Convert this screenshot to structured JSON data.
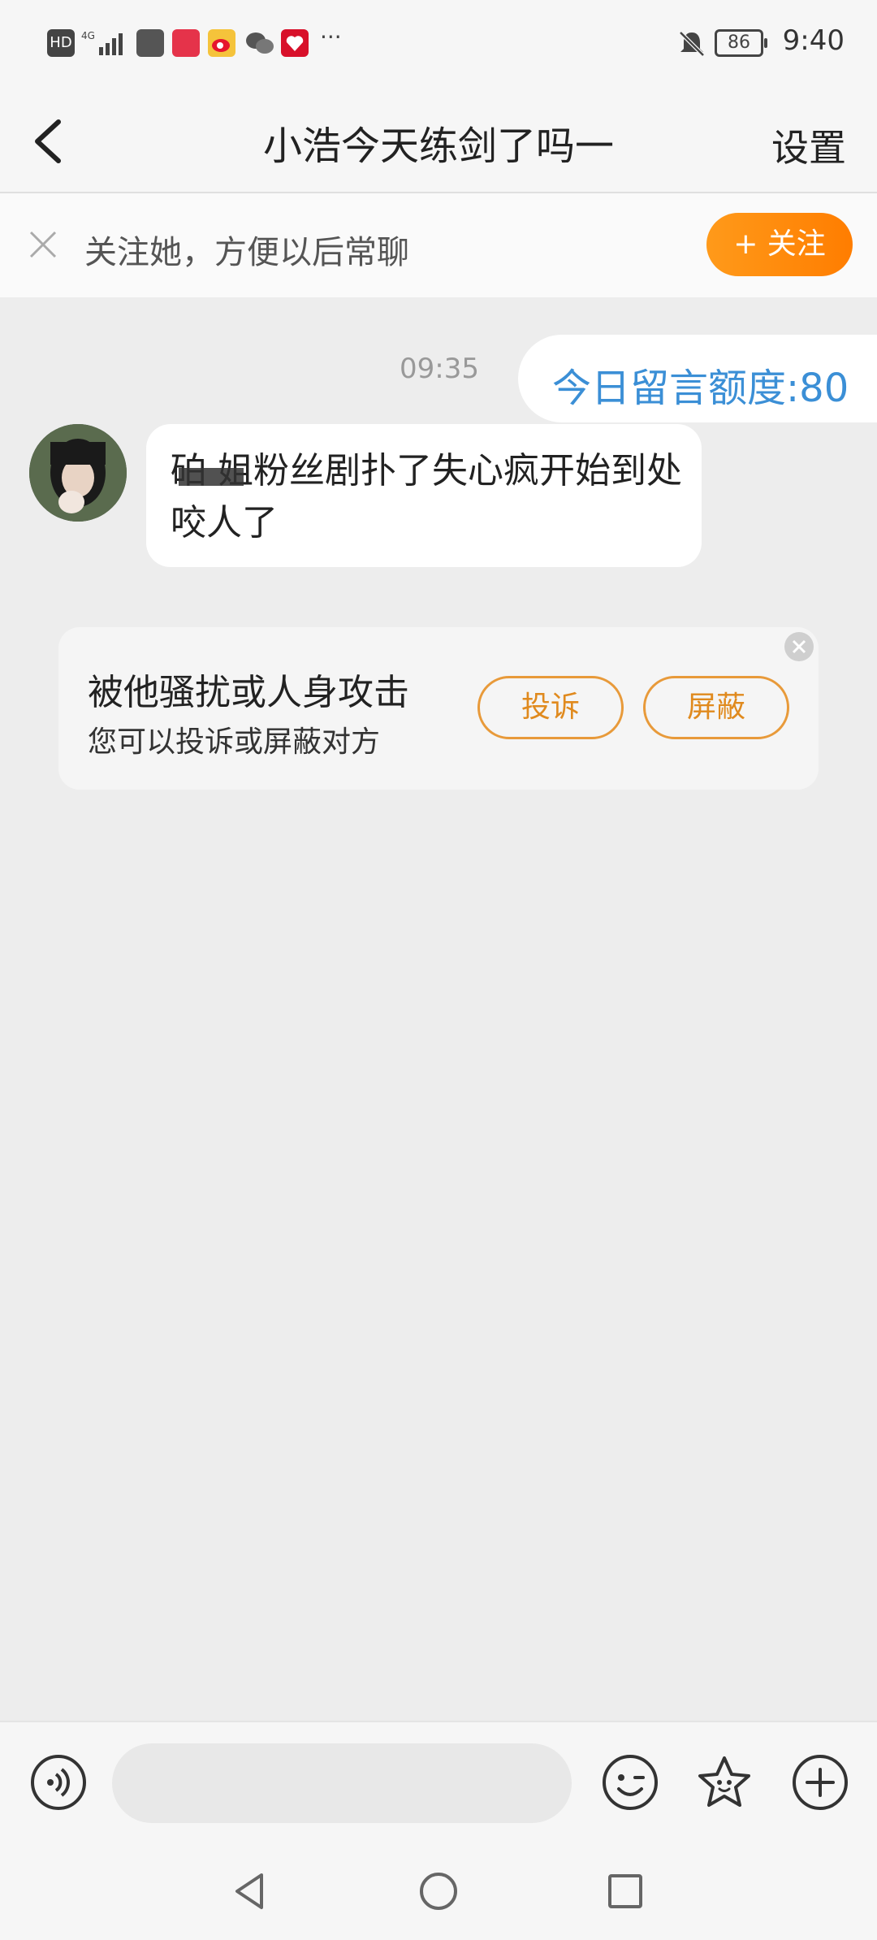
{
  "status_bar": {
    "network": "4G",
    "battery": "86",
    "time": "9:40"
  },
  "header": {
    "title": "小浩今天练剑了吗一",
    "settings_label": "设置"
  },
  "follow_banner": {
    "text": "关注她，方便以后常聊",
    "follow_label": "+ 关注"
  },
  "chat": {
    "quota_text": "今日留言额度:80",
    "timestamp": "09:35",
    "message": "砶  姐粉丝剧扑了失心疯开始到处咬人了"
  },
  "report_card": {
    "title": "被他骚扰或人身攻击",
    "subtitle": "您可以投诉或屏蔽对方",
    "complain_label": "投诉",
    "block_label": "屏蔽"
  },
  "input_bar": {
    "placeholder": ""
  },
  "colors": {
    "accent_orange": "#ff8a00",
    "quota_blue": "#3b8fd6",
    "background": "#ededed"
  }
}
